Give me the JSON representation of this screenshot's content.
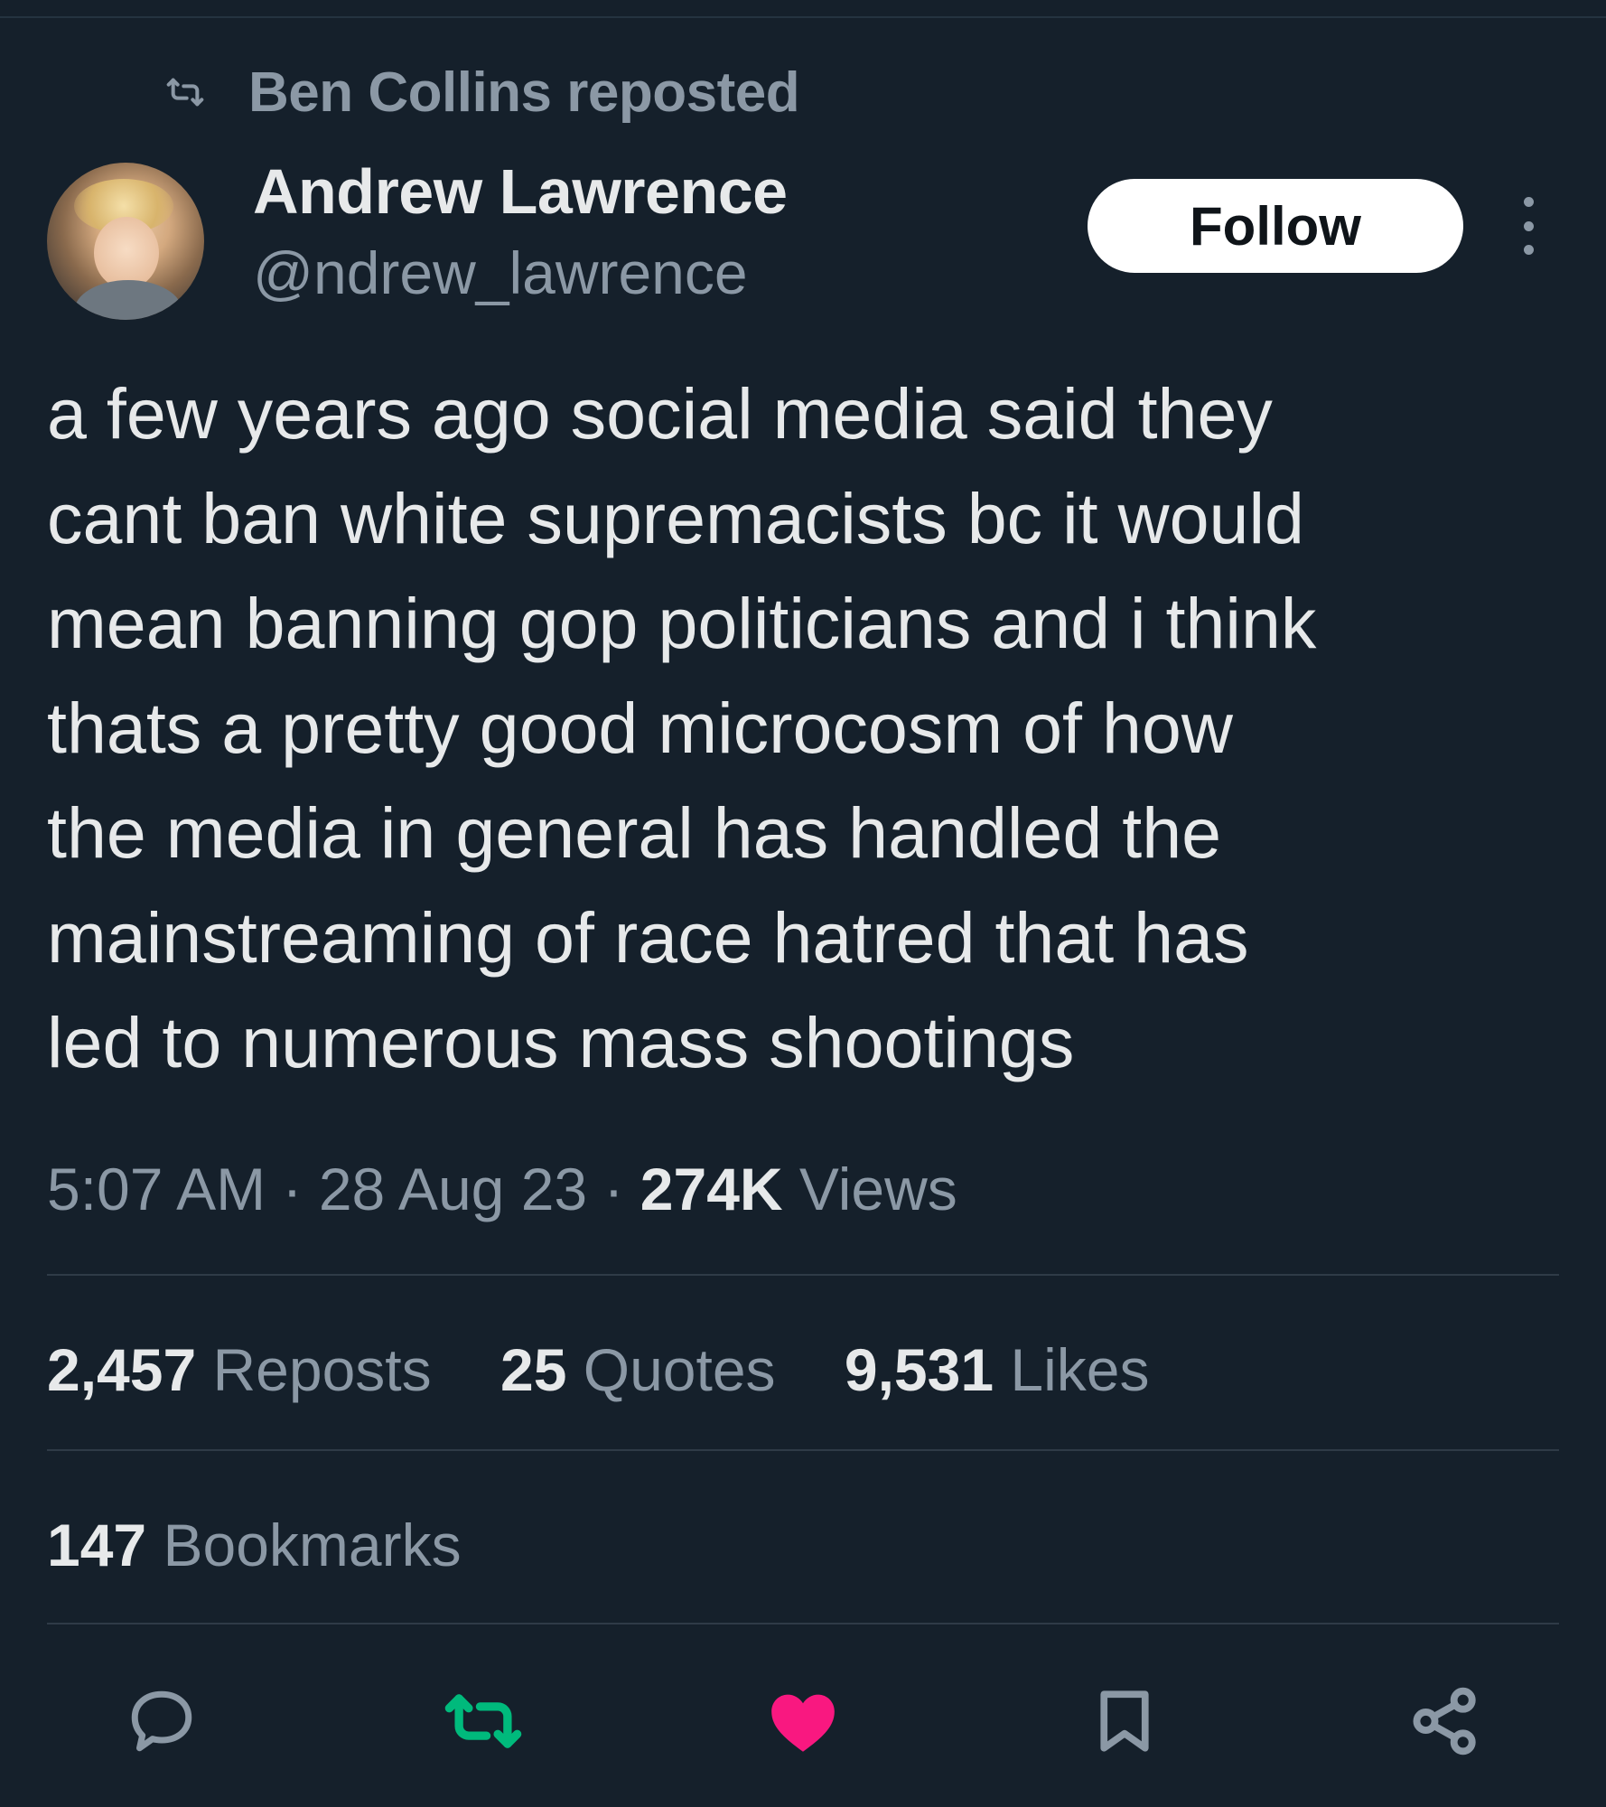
{
  "repost_banner": {
    "text": "Ben Collins reposted",
    "icon": "repost-icon"
  },
  "author": {
    "name": "Andrew Lawrence",
    "handle": "@ndrew_lawrence"
  },
  "follow_label": "Follow",
  "tweet": {
    "lines": [
      "a few years ago social media said they",
      "cant ban white supremacists bc it would",
      "mean banning gop politicians and i think",
      "thats a pretty good microcosm of how",
      "the media in general has handled the",
      "mainstreaming of race hatred that has",
      "led to numerous mass shootings"
    ]
  },
  "meta": {
    "time": "5:07 AM",
    "separator": "·",
    "date": "28 Aug 23",
    "views_count": "274K",
    "views_label": "Views"
  },
  "stats": {
    "reposts": {
      "count": "2,457",
      "label": "Reposts"
    },
    "quotes": {
      "count": "25",
      "label": "Quotes"
    },
    "likes": {
      "count": "9,531",
      "label": "Likes"
    },
    "bookmarks": {
      "count": "147",
      "label": "Bookmarks"
    }
  },
  "actions": [
    "reply-icon",
    "repost-icon",
    "like-icon",
    "bookmark-icon",
    "share-icon"
  ],
  "colors": {
    "background": "#15202b",
    "text": "#e7e9ea",
    "muted": "#8b98a5",
    "repost_active": "#00ba7c",
    "like_active": "#f91880"
  }
}
